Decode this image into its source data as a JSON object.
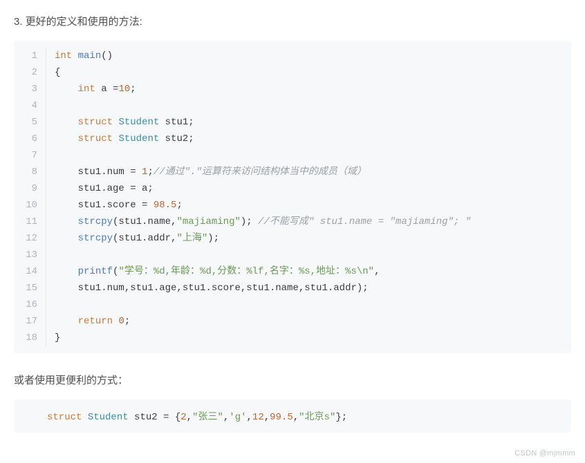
{
  "heading": "3. 更好的定义和使用的方法:",
  "code": {
    "lines": [
      {
        "n": "1",
        "tokens": [
          [
            "kw",
            "int"
          ],
          [
            "pln",
            " "
          ],
          [
            "fn",
            "main"
          ],
          [
            "pln",
            "()"
          ]
        ]
      },
      {
        "n": "2",
        "tokens": [
          [
            "pln",
            "{"
          ]
        ]
      },
      {
        "n": "3",
        "tokens": [
          [
            "pln",
            "    "
          ],
          [
            "kw",
            "int"
          ],
          [
            "pln",
            " a ="
          ],
          [
            "num",
            "10"
          ],
          [
            "pln",
            ";"
          ]
        ]
      },
      {
        "n": "4",
        "tokens": []
      },
      {
        "n": "5",
        "tokens": [
          [
            "pln",
            "    "
          ],
          [
            "kw",
            "struct"
          ],
          [
            "pln",
            " "
          ],
          [
            "type2",
            "Student"
          ],
          [
            "pln",
            " stu1;"
          ]
        ]
      },
      {
        "n": "6",
        "tokens": [
          [
            "pln",
            "    "
          ],
          [
            "kw",
            "struct"
          ],
          [
            "pln",
            " "
          ],
          [
            "type2",
            "Student"
          ],
          [
            "pln",
            " stu2;"
          ]
        ]
      },
      {
        "n": "7",
        "tokens": []
      },
      {
        "n": "8",
        "tokens": [
          [
            "pln",
            "    stu1.num = "
          ],
          [
            "num",
            "1"
          ],
          [
            "pln",
            ";"
          ],
          [
            "comm",
            "//通过\".\"运算符来访问结构体当中的成员（域）"
          ]
        ]
      },
      {
        "n": "9",
        "tokens": [
          [
            "pln",
            "    stu1.age = a;"
          ]
        ]
      },
      {
        "n": "10",
        "tokens": [
          [
            "pln",
            "    stu1.score = "
          ],
          [
            "num",
            "98.5"
          ],
          [
            "pln",
            ";"
          ]
        ]
      },
      {
        "n": "11",
        "tokens": [
          [
            "pln",
            "    "
          ],
          [
            "fn",
            "strcpy"
          ],
          [
            "pln",
            "(stu1.name,"
          ],
          [
            "str",
            "\"majiaming\""
          ],
          [
            "pln",
            "); "
          ],
          [
            "comm",
            "//不能写成\" stu1.name = \"majiaming\"; \""
          ]
        ]
      },
      {
        "n": "12",
        "tokens": [
          [
            "pln",
            "    "
          ],
          [
            "fn",
            "strcpy"
          ],
          [
            "pln",
            "(stu1.addr,"
          ],
          [
            "str",
            "\"上海\""
          ],
          [
            "pln",
            ");"
          ]
        ]
      },
      {
        "n": "13",
        "tokens": []
      },
      {
        "n": "14",
        "tokens": [
          [
            "pln",
            "    "
          ],
          [
            "fn",
            "printf"
          ],
          [
            "pln",
            "("
          ],
          [
            "str",
            "\"学号：%d,年龄：%d,分数：%lf,名字：%s,地址：%s\\n\""
          ],
          [
            "pln",
            ","
          ]
        ]
      },
      {
        "n": "15",
        "tokens": [
          [
            "pln",
            "    stu1.num,stu1.age,stu1.score,stu1.name,stu1.addr);"
          ]
        ]
      },
      {
        "n": "16",
        "tokens": []
      },
      {
        "n": "17",
        "tokens": [
          [
            "pln",
            "    "
          ],
          [
            "kw",
            "return"
          ],
          [
            "pln",
            " "
          ],
          [
            "num",
            "0"
          ],
          [
            "pln",
            ";"
          ]
        ]
      },
      {
        "n": "18",
        "tokens": [
          [
            "pln",
            "}"
          ]
        ]
      }
    ]
  },
  "middle_text": "或者使用更便利的方式：",
  "code2": {
    "tokens": [
      [
        "kw",
        "struct"
      ],
      [
        "pln",
        " "
      ],
      [
        "type2",
        "Student"
      ],
      [
        "pln",
        " stu2 = {"
      ],
      [
        "num",
        "2"
      ],
      [
        "pln",
        ","
      ],
      [
        "str",
        "\"张三\""
      ],
      [
        "pln",
        ","
      ],
      [
        "str",
        "'g'"
      ],
      [
        "pln",
        ","
      ],
      [
        "num",
        "12"
      ],
      [
        "pln",
        ","
      ],
      [
        "num",
        "99.5"
      ],
      [
        "pln",
        ","
      ],
      [
        "str",
        "\"北京s\""
      ],
      [
        "pln",
        "};"
      ]
    ]
  },
  "watermark": "CSDN @mjmmm"
}
